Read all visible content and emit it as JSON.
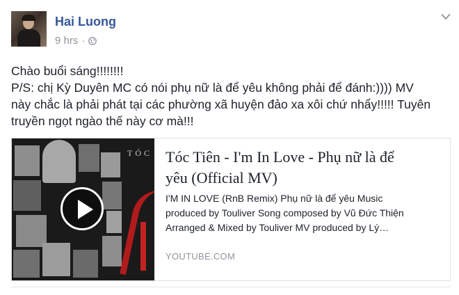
{
  "post": {
    "author": "Hai Luong",
    "time": "9 hrs",
    "separator": "·",
    "privacy_icon": "globe-icon",
    "menu_icon": "chevron-down-icon",
    "message_lines": [
      "Chào buổi sáng!!!!!!!!",
      "P/S: chị Kỳ Duyên MC có nói phụ nữ là để yêu không phải để đánh:)))) MV",
      "này chắc là phải phát tại các phường xã huyện đảo xa xôi chứ nhẩy!!!!! Tuyên",
      "truyền ngọt ngào thế này cơ mà!!!"
    ]
  },
  "link_card": {
    "title_lines": [
      "Tóc Tiên - I'm In Love - Phụ nữ là để",
      "yêu (Official MV)"
    ],
    "description_lines": [
      "I'M IN LOVE (RnB Remix) Phụ nữ là để yêu Music",
      "produced by Touliver Song composed by Vũ Đức Thiện",
      "Arranged & Mixed by Touliver MV produced by Lý…"
    ],
    "domain": "YOUTUBE.COM",
    "thumbnail_text": "TÓC",
    "play_icon": "play-icon"
  },
  "colors": {
    "author_link": "#365899",
    "meta_gray": "#90949c",
    "text": "#1d2129",
    "card_border": "#dddfe2"
  }
}
